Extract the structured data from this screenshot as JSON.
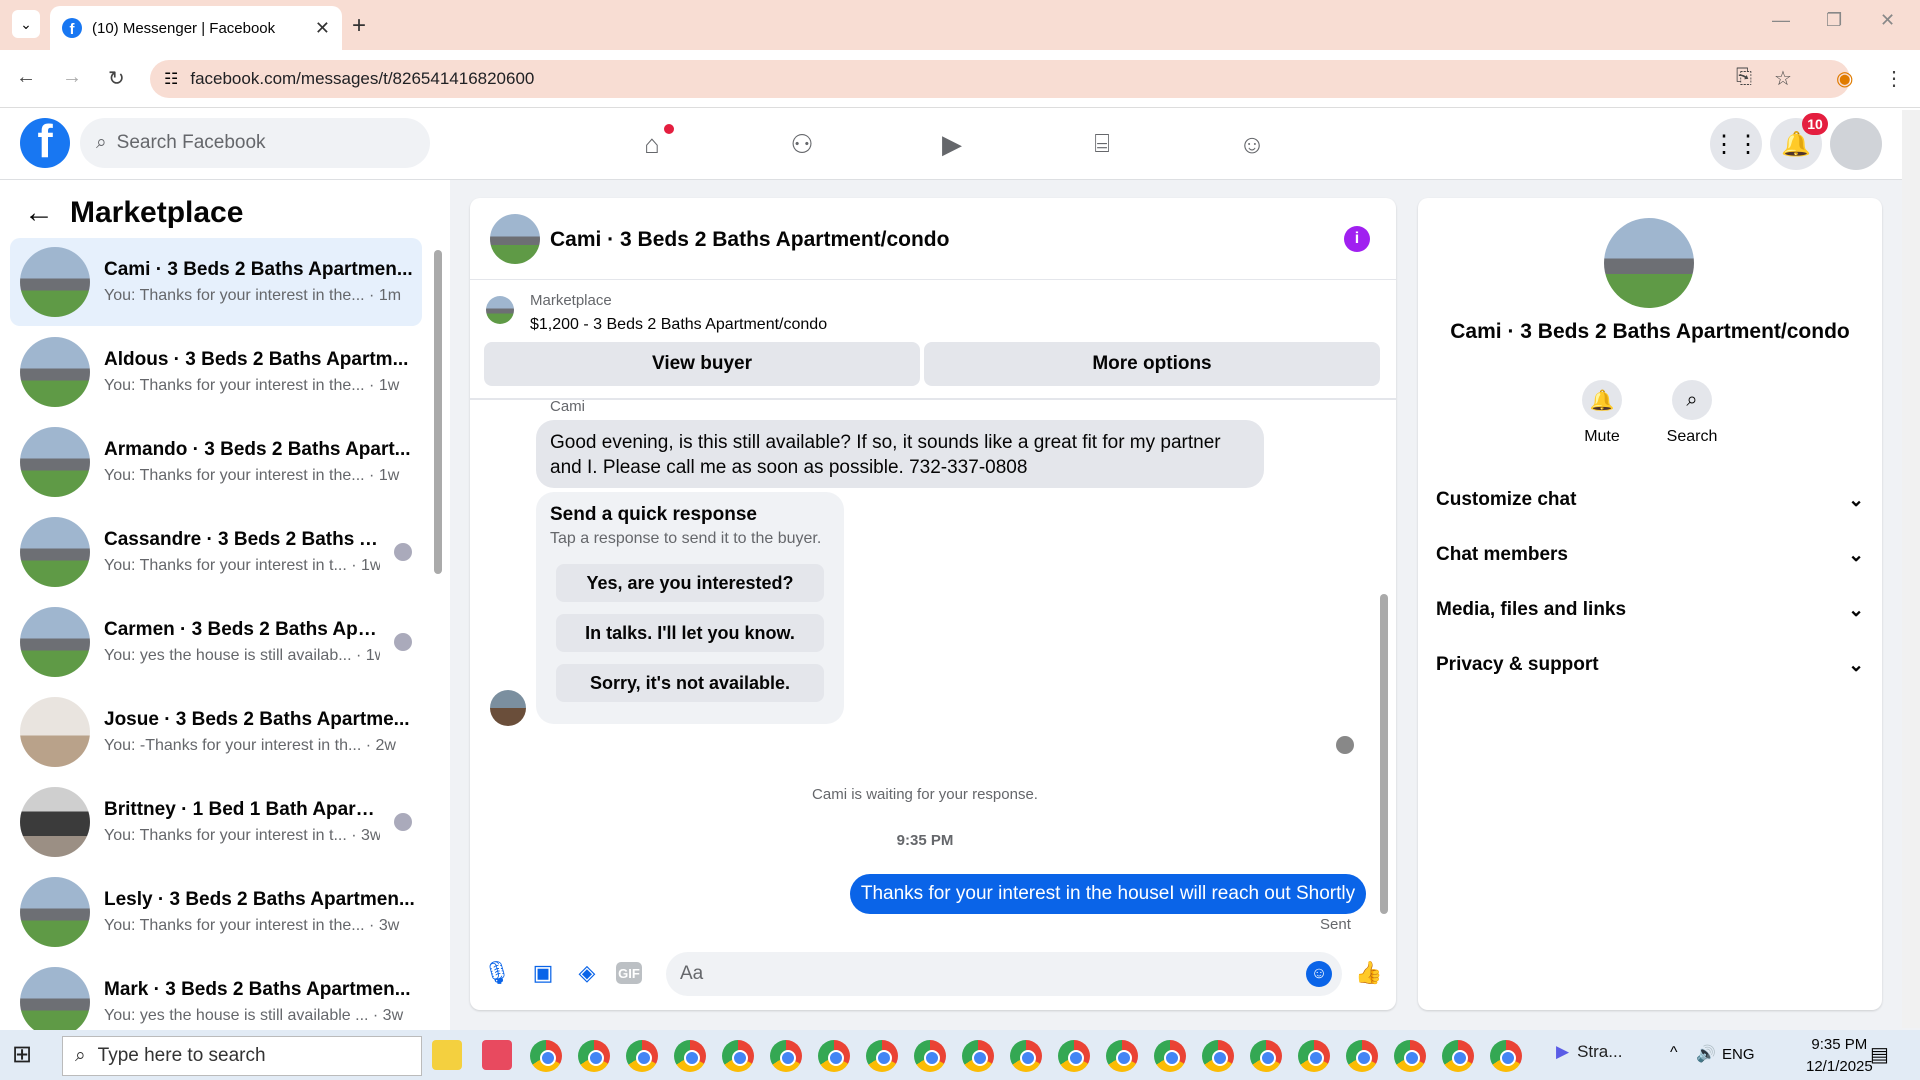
{
  "browser": {
    "tab_title": "(10) Messenger | Facebook",
    "url": "facebook.com/messages/t/826541416820600",
    "favicon_letter": "f",
    "new_tab_label": "+",
    "tab_close_label": "✕"
  },
  "fb_header": {
    "logo_letter": "f",
    "search_placeholder": "Search Facebook",
    "notification_count": "10",
    "nav_icons": [
      "home-icon",
      "friends-icon",
      "video-icon",
      "marketplace-icon",
      "groups-icon"
    ]
  },
  "sidebar": {
    "title": "Marketplace",
    "conversations": [
      {
        "name": "Cami · 3 Beds 2 Baths Apartmen...",
        "snippet": "You: Thanks for your interest in the...",
        "time": "1m",
        "active": true,
        "avatar": "house"
      },
      {
        "name": "Aldous · 3 Beds 2 Baths Apartm...",
        "snippet": "You: Thanks for your interest in the...",
        "time": "1w",
        "avatar": "house"
      },
      {
        "name": "Armando · 3 Beds 2 Baths Apart...",
        "snippet": "You: Thanks for your interest in the...",
        "time": "1w",
        "avatar": "house"
      },
      {
        "name": "Cassandre · 3 Beds 2 Baths Ap...",
        "snippet": "You: Thanks for your interest in t...",
        "time": "1w",
        "avatar": "house"
      },
      {
        "name": "Carmen · 3 Beds 2 Baths Apar...",
        "snippet": "You: yes the house is still availab...",
        "time": "1w",
        "avatar": "house"
      },
      {
        "name": "Josue · 3 Beds 2 Baths Apartme...",
        "snippet": "You: -Thanks for your interest in th...",
        "time": "2w",
        "avatar": "interior"
      },
      {
        "name": "Brittney · 1 Bed 1 Bath Apartm...",
        "snippet": "You: Thanks for your interest in t...",
        "time": "3w",
        "avatar": "kitchen"
      },
      {
        "name": "Lesly · 3 Beds 2 Baths Apartmen...",
        "snippet": "You: Thanks for your interest in the...",
        "time": "3w",
        "avatar": "house"
      },
      {
        "name": "Mark · 3 Beds 2 Baths Apartmen...",
        "snippet": "You: yes the house is still available ...",
        "time": "3w",
        "avatar": "house"
      }
    ]
  },
  "chat": {
    "title": "Cami · 3 Beds 2 Baths Apartment/condo",
    "marketplace_label": "Marketplace",
    "listing": "$1,200 - 3 Beds 2 Baths Apartment/condo",
    "view_buyer": "View buyer",
    "more_options": "More options",
    "sender_name": "Cami",
    "incoming_message": "Good evening, is this still available? If so, it sounds like a great fit for my partner and I. Please call me as soon as possible. 732-337-0808",
    "quick_response_title": "Send a quick response",
    "quick_response_sub": "Tap a response to send it to the buyer.",
    "quick_responses": [
      "Yes, are you interested?",
      "In talks. I'll let you know.",
      "Sorry, it's not available."
    ],
    "waiting_text": "Cami is waiting for your response.",
    "timestamp": "9:35 PM",
    "outgoing_message": "Thanks for your interest in the houseI will reach out Shortly",
    "sent_label": "Sent",
    "input_placeholder": "Aa"
  },
  "right_panel": {
    "name": "Cami · 3 Beds 2 Baths Apartment/condo",
    "actions": [
      {
        "label": "Mute",
        "icon": "bell-icon"
      },
      {
        "label": "Search",
        "icon": "search-icon"
      }
    ],
    "sections": [
      "Customize chat",
      "Chat members",
      "Media, files and links",
      "Privacy & support"
    ]
  },
  "taskbar": {
    "search_placeholder": "Type here to search",
    "app_label": "Stra...",
    "lang": "ENG",
    "time": "9:35 PM",
    "date": "12/1/2025"
  },
  "colors": {
    "fb_blue": "#1877f2",
    "messenger_blue": "#0a64e8",
    "info_purple": "#a020f0",
    "badge_red": "#e41e3f"
  }
}
